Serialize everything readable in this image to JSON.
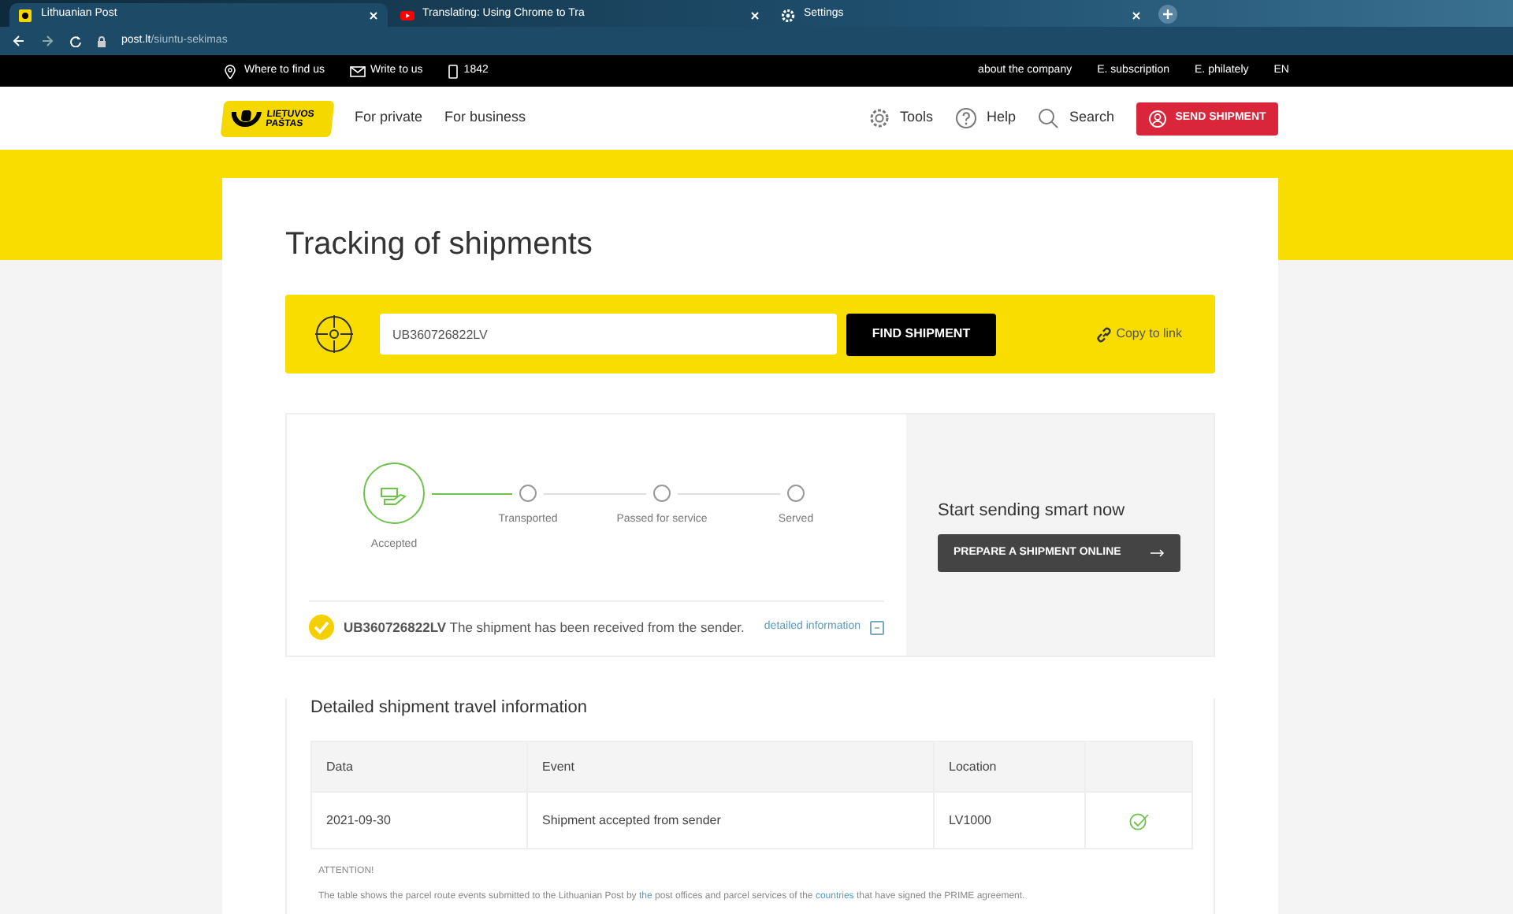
{
  "browser": {
    "tabs": [
      {
        "title": "Lithuanian Post",
        "kind": "post",
        "selected": true
      },
      {
        "title": "Translating: Using Chrome to Tra",
        "kind": "video",
        "selected": false
      },
      {
        "title": "Settings",
        "kind": "gear",
        "selected": false
      }
    ],
    "url_host": "post.lt",
    "url_path": "/siuntu-sekimas"
  },
  "top_bar": {
    "left": [
      {
        "kind": "pin",
        "label": "Where to find us"
      },
      {
        "kind": "mail",
        "label": "Write to us"
      },
      {
        "kind": "phone",
        "label": "1842"
      }
    ],
    "right": [
      "about the company",
      "E. subscription",
      "E. philately",
      "EN"
    ]
  },
  "header": {
    "logo": [
      "LIETUVOS",
      "PAŠTAS"
    ],
    "nav": [
      "For private",
      "For business"
    ],
    "tools": [
      {
        "kind": "gear",
        "label": "Tools"
      },
      {
        "kind": "help",
        "label": "Help"
      },
      {
        "kind": "search",
        "label": "Search"
      }
    ],
    "cta": "SEND SHIPMENT"
  },
  "page_title": "Tracking of shipments",
  "search": {
    "value": "UB360726822LV",
    "button": "FIND SHIPMENT",
    "copy_link": "Copy to link"
  },
  "progress": {
    "steps": [
      {
        "label": "Accepted",
        "done": true
      },
      {
        "label": "Transported",
        "done": false
      },
      {
        "label": "Passed for service",
        "done": false
      },
      {
        "label": "Served",
        "done": false
      }
    ],
    "status": "**UB360726822LV** The shipment has been received from the sender.",
    "details_link": "detailed information",
    "details_expanded": true
  },
  "promo": {
    "title": "Start sending smart now",
    "button": "PREPARE A SHIPMENT ONLINE"
  },
  "details": {
    "title": "Detailed shipment travel information",
    "columns": [
      "Data",
      "Event",
      "Location"
    ],
    "rows": [
      {
        "date": "2021-09-30",
        "event": "Shipment accepted from sender",
        "location": "LV1000",
        "confirmed": true
      }
    ],
    "attention": "ATTENTION!",
    "note": [
      {
        "kind": "text",
        "text": "The table shows the parcel route events submitted to the Lithuanian Post by"
      },
      {
        "kind": "link",
        "text": "the"
      },
      {
        "kind": "text",
        "text": "post offices and parcel services of the"
      },
      {
        "kind": "link",
        "text": "countries"
      },
      {
        "kind": "text",
        "text": "that have signed the PRIME agreement."
      }
    ]
  }
}
